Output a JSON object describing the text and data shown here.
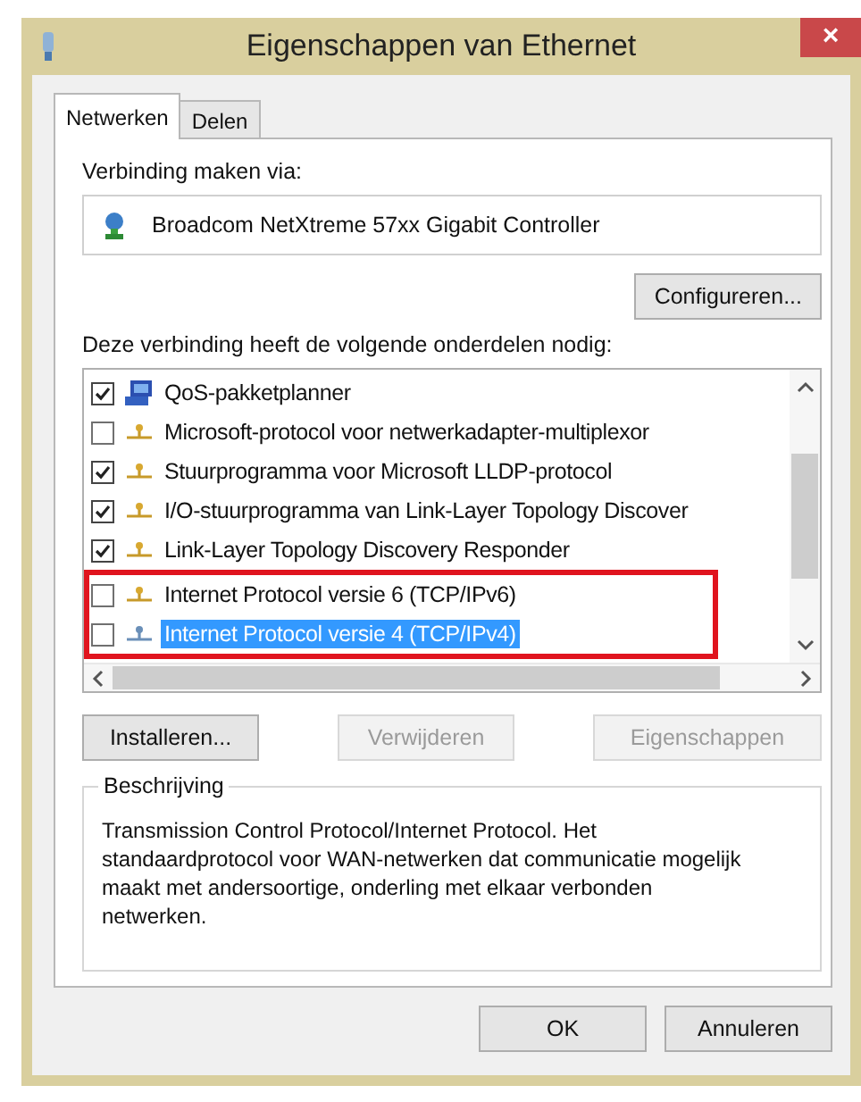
{
  "window": {
    "title": "Eigenschappen van Ethernet",
    "close": "×"
  },
  "tabs": [
    {
      "label": "Netwerken",
      "selected": true
    },
    {
      "label": "Delen",
      "selected": false
    }
  ],
  "connect_label": "Verbinding maken via:",
  "adapter": "Broadcom NetXtreme 57xx Gigabit Controller",
  "configure_button": "Configureren...",
  "components_label": "Deze verbinding heeft de volgende onderdelen nodig:",
  "components": [
    {
      "kind": "scheduler",
      "label": "QoS-pakketplanner",
      "checked": true,
      "selected": false,
      "boxed": false
    },
    {
      "kind": "protocol",
      "label": "Microsoft-protocol voor netwerkadapter-multiplexor",
      "checked": false,
      "selected": false,
      "boxed": false
    },
    {
      "kind": "protocol",
      "label": "Stuurprogramma voor Microsoft LLDP-protocol",
      "checked": true,
      "selected": false,
      "boxed": false
    },
    {
      "kind": "protocol",
      "label": "I/O-stuurprogramma van Link-Layer Topology Discover",
      "checked": true,
      "selected": false,
      "boxed": false
    },
    {
      "kind": "protocol",
      "label": "Link-Layer Topology Discovery Responder",
      "checked": true,
      "selected": false,
      "boxed": false
    },
    {
      "kind": "protocol",
      "label": "Internet Protocol versie 6 (TCP/IPv6)",
      "checked": false,
      "selected": false,
      "boxed": true
    },
    {
      "kind": "protocol",
      "label": "Internet Protocol versie 4 (TCP/IPv4)",
      "checked": false,
      "selected": true,
      "boxed": true
    }
  ],
  "action_buttons": [
    {
      "label": "Installeren...",
      "disabled": false
    },
    {
      "label": "Verwijderen",
      "disabled": true
    },
    {
      "label": "Eigenschappen",
      "disabled": true
    }
  ],
  "description": {
    "title": "Beschrijving",
    "text": "Transmission Control Protocol/Internet Protocol. Het standaardprotocol voor WAN-netwerken dat communicatie mogelijk maakt met andersoortige, onderling met elkaar verbonden netwerken."
  },
  "dialog_buttons": [
    "OK",
    "Annuleren"
  ]
}
